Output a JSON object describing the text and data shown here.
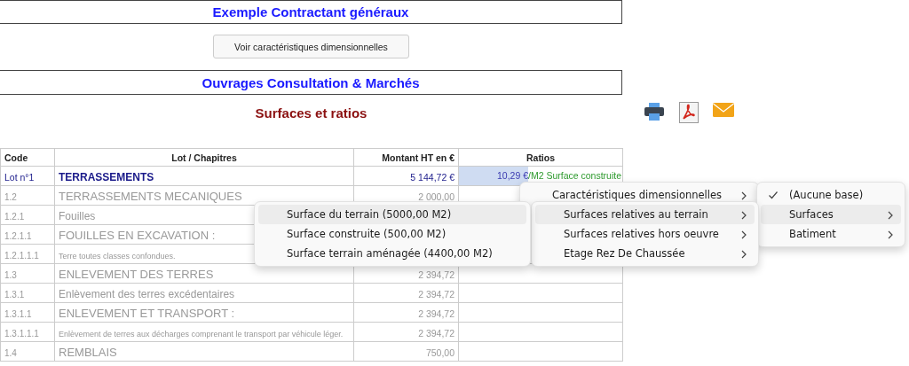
{
  "header_title": "Exemple Contractant généraux",
  "button": "Voir caractéristiques dimensionnelles",
  "section_title": "Ouvrages Consultation & Marchés",
  "subtitle": "Surfaces et ratios",
  "table": {
    "columns": [
      "Code",
      "Lot / Chapitres",
      "Montant HT en €",
      "Ratios"
    ],
    "rows": [
      {
        "kind": "lot",
        "code": "Lot n°1",
        "label": "TERRASSEMENTS",
        "amount": "5 144,72 €",
        "ratio_value": "10,29 €",
        "ratio_label": "/M2 Surface construite",
        "ratio_selected": true
      },
      {
        "kind": "chapter",
        "code": "1.2",
        "label": "TERRASSEMENTS MECANIQUES",
        "amount": "2 000,00"
      },
      {
        "kind": "sub",
        "code": "1.2.1",
        "label": "Fouilles"
      },
      {
        "kind": "chapter",
        "code": "1.2.1.1",
        "label": "FOUILLES EN EXCAVATION :"
      },
      {
        "kind": "detail",
        "code": "1.2.1.1.1",
        "label": "Terre toutes classes confondues."
      },
      {
        "kind": "chapter",
        "code": "1.3",
        "label": "ENLEVEMENT DES TERRES",
        "amount": "2 394,72"
      },
      {
        "kind": "sub",
        "code": "1.3.1",
        "label": "Enlèvement des terres excédentaires",
        "amount": "2 394,72"
      },
      {
        "kind": "chapter",
        "code": "1.3.1.1",
        "label": "ENLEVEMENT ET TRANSPORT :",
        "amount": "2 394,72"
      },
      {
        "kind": "detail",
        "code": "1.3.1.1.1",
        "label": "Enlèvement de terres aux décharges comprenant le transport par véhicule léger.",
        "amount": "2 394,72"
      },
      {
        "kind": "chapter",
        "code": "1.4",
        "label": "REMBLAIS",
        "amount": "750,00"
      }
    ]
  },
  "context_menus": [
    {
      "items": [
        {
          "label": "Surface du terrain (5000,00 M2)",
          "selected": true,
          "submenu": false
        },
        {
          "label": "Surface construite (500,00 M2)",
          "selected": false,
          "submenu": false
        },
        {
          "label": "Surface terrain aménagée (4400,00 M2)",
          "selected": false,
          "submenu": false
        }
      ]
    },
    {
      "items": [
        {
          "label": "Caractéristiques dimensionnelles",
          "selected": false,
          "submenu": true
        }
      ]
    },
    {
      "items": [
        {
          "label": "Surfaces relatives au terrain",
          "selected": true,
          "submenu": true
        },
        {
          "label": "Surfaces relatives hors oeuvre",
          "selected": false,
          "submenu": true
        },
        {
          "label": "Etage Rez De Chaussée",
          "selected": false,
          "submenu": true
        }
      ]
    },
    {
      "items": [
        {
          "label": "(Aucune base)",
          "selected": false,
          "submenu": false,
          "checked": true
        },
        {
          "label": "Surfaces",
          "selected": true,
          "submenu": true,
          "checked": false
        },
        {
          "label": "Batiment",
          "selected": false,
          "submenu": true,
          "checked": false
        }
      ]
    }
  ]
}
